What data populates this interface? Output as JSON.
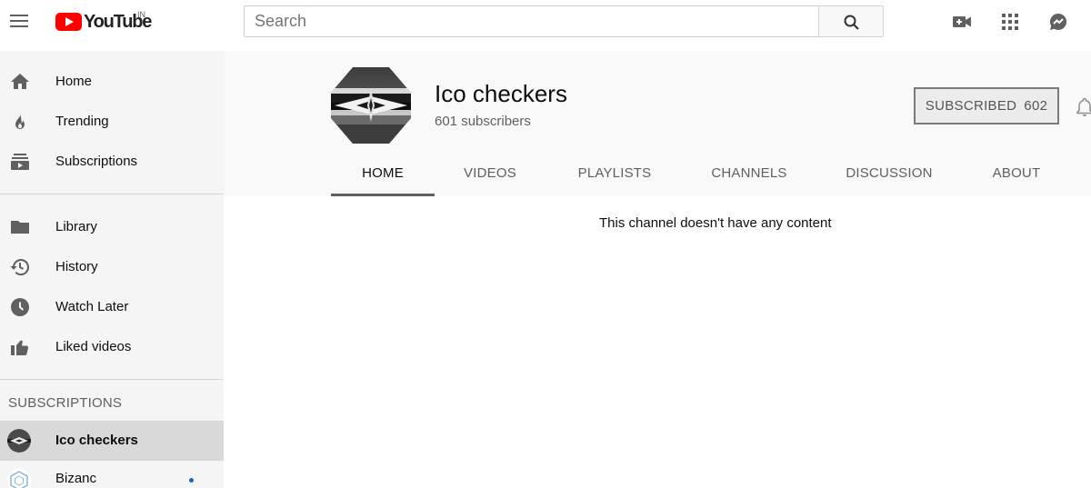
{
  "header": {
    "logo_text": "YouTube",
    "logo_country": "IN",
    "search_placeholder": "Search",
    "icons": [
      "menu-icon",
      "search-icon",
      "video-camera-plus-icon",
      "apps-grid-icon",
      "messages-icon"
    ]
  },
  "sidebar": {
    "primary": [
      {
        "label": "Home",
        "icon": "home-icon"
      },
      {
        "label": "Trending",
        "icon": "flame-icon"
      },
      {
        "label": "Subscriptions",
        "icon": "subscriptions-icon"
      }
    ],
    "library": [
      {
        "label": "Library",
        "icon": "folder-icon"
      },
      {
        "label": "History",
        "icon": "history-icon"
      },
      {
        "label": "Watch Later",
        "icon": "clock-icon"
      },
      {
        "label": "Liked videos",
        "icon": "thumbs-up-icon"
      }
    ],
    "subscriptions_heading": "SUBSCRIPTIONS",
    "subscriptions": [
      {
        "label": "Ico checkers",
        "active": true,
        "new_content": false
      },
      {
        "label": "Bizanc",
        "active": false,
        "new_content": true
      }
    ]
  },
  "channel": {
    "name": "Ico checkers",
    "subscribers": "601 subscribers",
    "subscribe_label": "SUBSCRIBED",
    "subscribe_count": "602",
    "tabs": [
      "HOME",
      "VIDEOS",
      "PLAYLISTS",
      "CHANNELS",
      "DISCUSSION",
      "ABOUT"
    ],
    "active_tab": "HOME",
    "empty_message": "This channel doesn't have any content"
  },
  "colors": {
    "brand_red": "#ff0000",
    "sidebar_bg": "#f5f5f5",
    "header_bg": "#f9f9f9",
    "active_item_bg": "#d9d9d9",
    "dot_blue": "#1c62b9"
  }
}
